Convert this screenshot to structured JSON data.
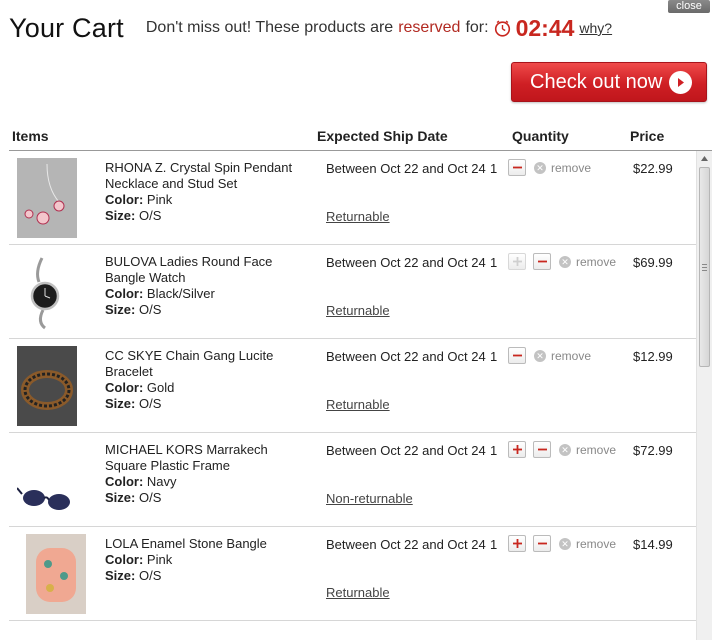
{
  "close_label": "close",
  "header": {
    "title": "Your Cart",
    "message_prefix": "Don't miss out! These products are",
    "message_reserved": "reserved",
    "message_suffix": "for:",
    "timer": "02:44",
    "why_link": "why?"
  },
  "checkout_label": "Check out now",
  "columns": {
    "items": "Items",
    "ship_date": "Expected Ship Date",
    "quantity": "Quantity",
    "price": "Price"
  },
  "color_label": "Color:",
  "size_label": "Size:",
  "remove_label": "remove",
  "items": [
    {
      "name": "RHONA Z. Crystal Spin Pendant Necklace and Stud Set",
      "color": "Pink",
      "size": "O/S",
      "ship": "Between Oct 22 and Oct 24",
      "returnable": "Returnable",
      "qty": "1",
      "has_plus": false,
      "plus_disabled": false,
      "price": "$22.99",
      "thumb": "necklace-icon"
    },
    {
      "name": "BULOVA Ladies Round Face Bangle Watch",
      "color": "Black/Silver",
      "size": "O/S",
      "ship": "Between Oct 22 and Oct 24",
      "returnable": "Returnable",
      "qty": "1",
      "has_plus": true,
      "plus_disabled": true,
      "price": "$69.99",
      "thumb": "watch-icon"
    },
    {
      "name": "CC SKYE Chain Gang Lucite Bracelet",
      "color": "Gold",
      "size": "O/S",
      "ship": "Between Oct 22 and Oct 24",
      "returnable": "Returnable",
      "qty": "1",
      "has_plus": false,
      "plus_disabled": false,
      "price": "$12.99",
      "thumb": "bracelet-icon"
    },
    {
      "name": "MICHAEL KORS Marrakech Square Plastic Frame",
      "color": "Navy",
      "size": "O/S",
      "ship": "Between Oct 22 and Oct 24",
      "returnable": "Non-returnable",
      "qty": "1",
      "has_plus": true,
      "plus_disabled": false,
      "price": "$72.99",
      "thumb": "sunglasses-icon"
    },
    {
      "name": "LOLA Enamel Stone Bangle",
      "color": "Pink",
      "size": "O/S",
      "ship": "Between Oct 22 and Oct 24",
      "returnable": "Returnable",
      "qty": "1",
      "has_plus": true,
      "plus_disabled": false,
      "price": "$14.99",
      "thumb": "bangle-icon"
    }
  ],
  "colors": {
    "accent_red": "#c8271f",
    "reserved_red": "#b22a22",
    "button_red": "#cf1f24"
  }
}
